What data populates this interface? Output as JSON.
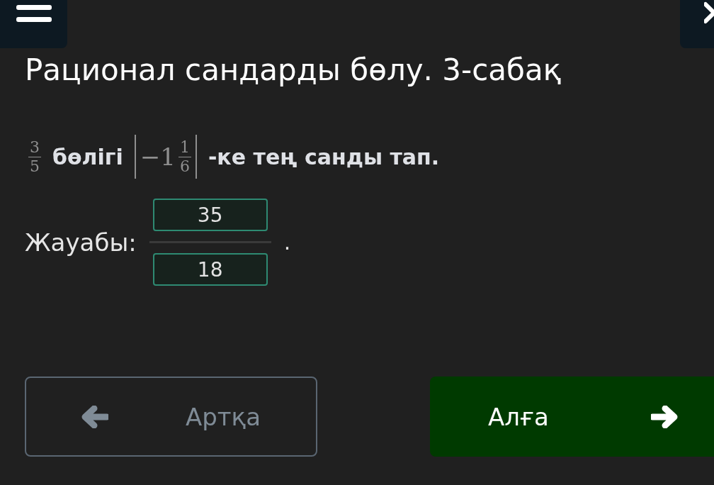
{
  "title": "Рационал сандарды бөлу. 3-сабақ",
  "question": {
    "fraction": {
      "numerator": "3",
      "denominator": "5"
    },
    "word_1": "бөлігі",
    "expression": {
      "sign": "−",
      "whole": "1",
      "numerator": "1",
      "denominator": "6"
    },
    "word_2": "-ке тең санды тап."
  },
  "answer": {
    "label": "Жауабы:",
    "numerator": "35",
    "denominator": "18",
    "period": "."
  },
  "buttons": [
    {
      "kind": "back",
      "label": "Артқа"
    },
    {
      "kind": "next",
      "label": "Алға"
    }
  ]
}
